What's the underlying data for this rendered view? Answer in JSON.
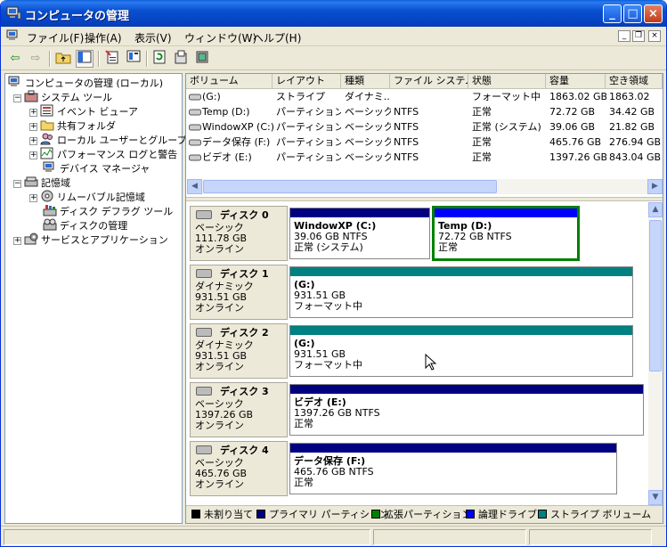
{
  "window": {
    "title": "コンピュータの管理"
  },
  "menu": [
    "ファイル(F)",
    "操作(A)",
    "表示(V)",
    "ウィンドウ(W)",
    "ヘルプ(H)"
  ],
  "tree": {
    "root": "コンピュータの管理 (ローカル)",
    "system_tools": "システム ツール",
    "event_viewer": "イベント ビューア",
    "shared_folders": "共有フォルダ",
    "local_users": "ローカル ユーザーとグループ",
    "perf_logs": "パフォーマンス ログと警告",
    "device_manager": "デバイス マネージャ",
    "storage": "記憶域",
    "removable": "リムーバブル記憶域",
    "defrag": "ディスク デフラグ ツール",
    "disk_mgmt": "ディスクの管理",
    "services": "サービスとアプリケーション"
  },
  "columns": [
    "ボリューム",
    "レイアウト",
    "種類",
    "ファイル システム",
    "状態",
    "容量",
    "空き領域"
  ],
  "volumes": [
    {
      "name": "(G:)",
      "layout": "ストライプ",
      "type": "ダイナミ...",
      "fs": "",
      "status": "フォーマット中",
      "capacity": "1863.02 GB",
      "free": "1863.02 "
    },
    {
      "name": "Temp (D:)",
      "layout": "パーティション",
      "type": "ベーシック",
      "fs": "NTFS",
      "status": "正常",
      "capacity": "72.72 GB",
      "free": "34.42 GB"
    },
    {
      "name": "WindowXP (C:)",
      "layout": "パーティション",
      "type": "ベーシック",
      "fs": "NTFS",
      "status": "正常 (システム)",
      "capacity": "39.06 GB",
      "free": "21.82 GB"
    },
    {
      "name": "データ保存 (F:)",
      "layout": "パーティション",
      "type": "ベーシック",
      "fs": "NTFS",
      "status": "正常",
      "capacity": "465.76 GB",
      "free": "276.94 GB"
    },
    {
      "name": "ビデオ (E:)",
      "layout": "パーティション",
      "type": "ベーシック",
      "fs": "NTFS",
      "status": "正常",
      "capacity": "1397.26 GB",
      "free": "843.04 GB"
    }
  ],
  "disks": [
    {
      "name": "ディスク 0",
      "kind": "ベーシック",
      "size": "111.78 GB",
      "state": "オンライン",
      "parts": [
        {
          "title": "WindowXP  (C:)",
          "line2": "39.06 GB NTFS",
          "line3": "正常 (システム)"
        },
        {
          "title": "Temp  (D:)",
          "line2": "72.72 GB NTFS",
          "line3": "正常"
        }
      ]
    },
    {
      "name": "ディスク 1",
      "kind": "ダイナミック",
      "size": "931.51 GB",
      "state": "オンライン",
      "parts": [
        {
          "title": "(G:)",
          "line2": "931.51 GB",
          "line3": "フォーマット中"
        }
      ]
    },
    {
      "name": "ディスク 2",
      "kind": "ダイナミック",
      "size": "931.51 GB",
      "state": "オンライン",
      "parts": [
        {
          "title": "(G:)",
          "line2": "931.51 GB",
          "line3": "フォーマット中"
        }
      ]
    },
    {
      "name": "ディスク 3",
      "kind": "ベーシック",
      "size": "1397.26 GB",
      "state": "オンライン",
      "parts": [
        {
          "title": "ビデオ  (E:)",
          "line2": "1397.26 GB NTFS",
          "line3": "正常"
        }
      ]
    },
    {
      "name": "ディスク 4",
      "kind": "ベーシック",
      "size": "465.76 GB",
      "state": "オンライン",
      "parts": [
        {
          "title": "データ保存  (F:)",
          "line2": "465.76 GB NTFS",
          "line3": "正常"
        }
      ]
    }
  ],
  "legend": [
    {
      "label": "未割り当て",
      "color": "#000000"
    },
    {
      "label": "プライマリ パーティション",
      "color": "#000080"
    },
    {
      "label": "拡張パーティション",
      "color": "#008000"
    },
    {
      "label": "論理ドライブ",
      "color": "#0000ff"
    },
    {
      "label": "ストライプ ボリューム",
      "color": "#008080"
    }
  ],
  "colors": {
    "primary": "#000080",
    "logical": "#0000ff",
    "extended": "#008000",
    "stripe": "#008080"
  }
}
